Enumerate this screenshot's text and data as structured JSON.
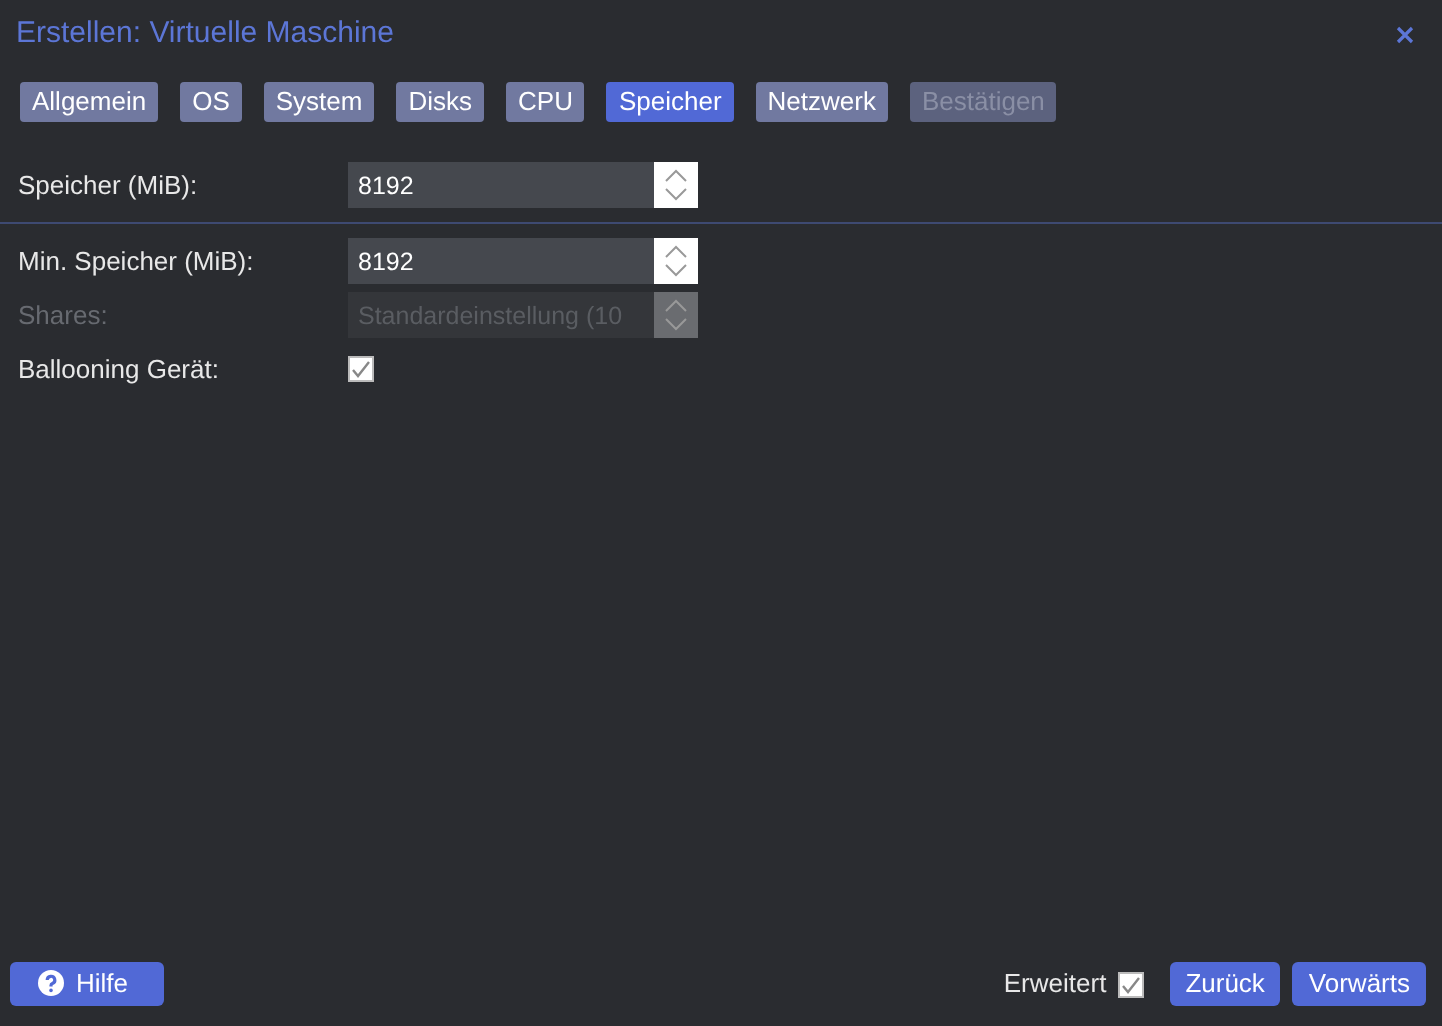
{
  "window": {
    "title": "Erstellen: Virtuelle Maschine"
  },
  "tabs": [
    {
      "label": "Allgemein",
      "selected": false,
      "disabled": false
    },
    {
      "label": "OS",
      "selected": false,
      "disabled": false
    },
    {
      "label": "System",
      "selected": false,
      "disabled": false
    },
    {
      "label": "Disks",
      "selected": false,
      "disabled": false
    },
    {
      "label": "CPU",
      "selected": false,
      "disabled": false
    },
    {
      "label": "Speicher",
      "selected": true,
      "disabled": false
    },
    {
      "label": "Netzwerk",
      "selected": false,
      "disabled": false
    },
    {
      "label": "Bestätigen",
      "selected": false,
      "disabled": true
    }
  ],
  "field_groups": [
    [
      {
        "kind": "spinner",
        "label": "Speicher (MiB):",
        "value": "8192",
        "disabled": false
      }
    ],
    [
      {
        "kind": "spinner",
        "label": "Min. Speicher (MiB):",
        "value": "8192",
        "disabled": false
      },
      {
        "kind": "spinner",
        "label": "Shares:",
        "placeholder": "Standardeinstellung (10",
        "disabled": true
      },
      {
        "kind": "checkbox",
        "label": "Ballooning Gerät:",
        "checked": true
      }
    ]
  ],
  "footer": {
    "help": "Hilfe",
    "advanced": {
      "label": "Erweitert",
      "checked": true
    },
    "buttons": [
      "Zurück",
      "Vorwärts"
    ]
  }
}
